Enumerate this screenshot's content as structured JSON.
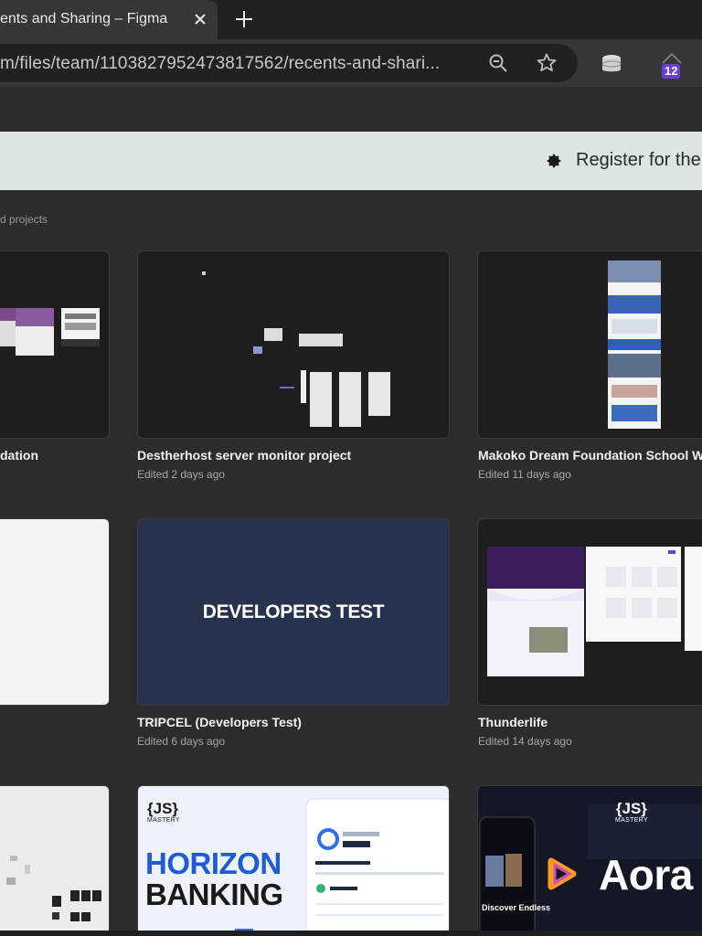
{
  "browser": {
    "tab_title": "ents and Sharing – Figma",
    "url": "m/files/team/1103827952473817562/recents-and-shari...",
    "extension_badge": "12"
  },
  "banner": {
    "text": "Register for the"
  },
  "section": {
    "label": "d projects"
  },
  "cards": [
    {
      "title": "dation",
      "subtitle": ""
    },
    {
      "title": "Destherhost server monitor project",
      "subtitle": "Edited 2 days ago"
    },
    {
      "title": "Makoko Dream Foundation School Webs",
      "subtitle": "Edited 11 days ago"
    },
    {
      "title": "",
      "subtitle": ""
    },
    {
      "title": "TRIPCEL (Developers Test)",
      "subtitle": "Edited 6 days ago",
      "thumb_text": "DEVELOPERS TEST"
    },
    {
      "title": "Thunderlife",
      "subtitle": "Edited 14 days ago"
    }
  ],
  "bottom_cards": {
    "horizon": {
      "brand_top": "{JS}",
      "brand_bottom": "MASTERY",
      "line1": "HORIZON",
      "line2": "BANKING"
    },
    "aora": {
      "brand_top": "{JS}",
      "brand_bottom": "MASTERY",
      "name": "Aora",
      "tagline": "Discover Endless"
    }
  },
  "colors": {
    "accent_purple": "#6b3fd4",
    "banner_bg": "#dbe6e3",
    "tripcel_bg": "#27324e",
    "horizon_blue": "#1f5bd6"
  }
}
